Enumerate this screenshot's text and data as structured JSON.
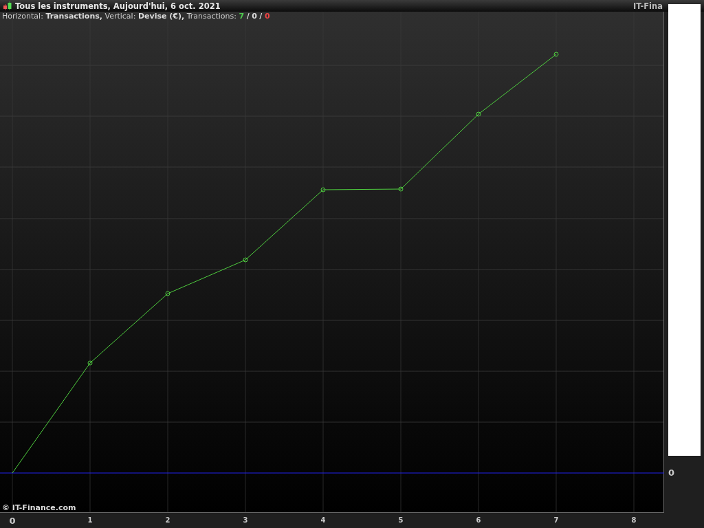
{
  "window": {
    "title": "Tous les instruments, Aujourd'hui, 6 oct. 2021",
    "brand": "IT-Fina"
  },
  "info": {
    "horizontal_label": "Horizontal:",
    "horizontal_value": "Transactions,",
    "vertical_label": "Vertical:",
    "vertical_value": "Devise (€),",
    "count_label": "Transactions:",
    "wins": "7",
    "sep1": "/",
    "even": "0",
    "sep2": "/",
    "losses": "0"
  },
  "chart": {
    "x_tick_labels": [
      "0",
      "1",
      "2",
      "3",
      "4",
      "5",
      "6",
      "7",
      "8"
    ],
    "y_tick_label": "0",
    "copyright": "© IT-Finance.com"
  }
}
